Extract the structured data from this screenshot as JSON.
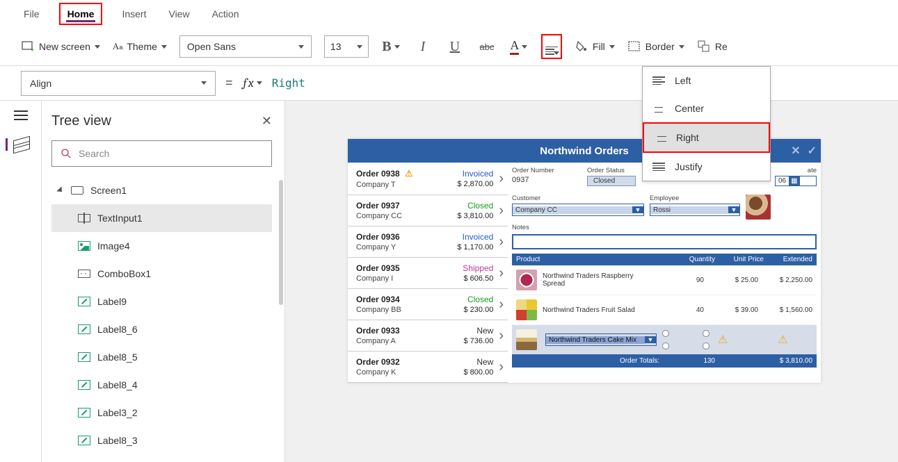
{
  "menu": {
    "file": "File",
    "home": "Home",
    "insert": "Insert",
    "view": "View",
    "action": "Action"
  },
  "ribbon": {
    "new_screen": "New screen",
    "theme": "Theme",
    "font": "Open Sans",
    "size": "13",
    "fill": "Fill",
    "border": "Border",
    "reorder_partial": "Re"
  },
  "align_menu": {
    "left": "Left",
    "center": "Center",
    "right": "Right",
    "justify": "Justify"
  },
  "formula": {
    "property": "Align",
    "value": "Right",
    "equals": "="
  },
  "tree": {
    "title": "Tree view",
    "search_placeholder": "Search",
    "screen": "Screen1",
    "items": [
      "TextInput1",
      "Image4",
      "ComboBox1",
      "Label9",
      "Label8_6",
      "Label8_5",
      "Label8_4",
      "Label3_2",
      "Label8_3"
    ]
  },
  "app": {
    "title": "Northwind Orders",
    "orders": [
      {
        "id": "Order 0938",
        "company": "Company T",
        "status": "Invoiced",
        "status_class": "invoiced",
        "price": "$ 2,870.00",
        "warn": true
      },
      {
        "id": "Order 0937",
        "company": "Company CC",
        "status": "Closed",
        "status_class": "closed",
        "price": "$ 3,810.00",
        "warn": false
      },
      {
        "id": "Order 0936",
        "company": "Company Y",
        "status": "Invoiced",
        "status_class": "invoiced",
        "price": "$ 1,170.00",
        "warn": false
      },
      {
        "id": "Order 0935",
        "company": "Company I",
        "status": "Shipped",
        "status_class": "shipped",
        "price": "$ 606.50",
        "warn": false
      },
      {
        "id": "Order 0934",
        "company": "Company BB",
        "status": "Closed",
        "status_class": "closed",
        "price": "$ 230.00",
        "warn": false
      },
      {
        "id": "Order 0933",
        "company": "Company A",
        "status": "New",
        "status_class": "new",
        "price": "$ 736.00",
        "warn": false
      },
      {
        "id": "Order 0932",
        "company": "Company K",
        "status": "New",
        "status_class": "new",
        "price": "$ 800.00",
        "warn": false
      }
    ],
    "detail": {
      "labels": {
        "order_number": "Order Number",
        "order_status": "Order Status",
        "order_date_partial": "ate",
        "customer": "Customer",
        "employee": "Employee",
        "notes": "Notes"
      },
      "order_number": "0937",
      "order_status": "Closed",
      "order_date": "06",
      "customer": "Company CC",
      "employee": "Rossi"
    },
    "products": {
      "headers": {
        "product": "Product",
        "qty": "Quantity",
        "unit": "Unit Price",
        "ext": "Extended"
      },
      "rows": [
        {
          "name": "Northwind Traders Raspberry Spread",
          "qty": "90",
          "unit": "$ 25.00",
          "ext": "$ 2,250.00",
          "thumb": "raspberry"
        },
        {
          "name": "Northwind Traders Fruit Salad",
          "qty": "40",
          "unit": "$ 39.00",
          "ext": "$ 1,560.00",
          "thumb": "fruit"
        }
      ],
      "new_item": "Northwind Traders Cake Mix",
      "totals": {
        "label": "Order Totals:",
        "qty": "130",
        "ext": "$ 3,810.00"
      }
    }
  }
}
